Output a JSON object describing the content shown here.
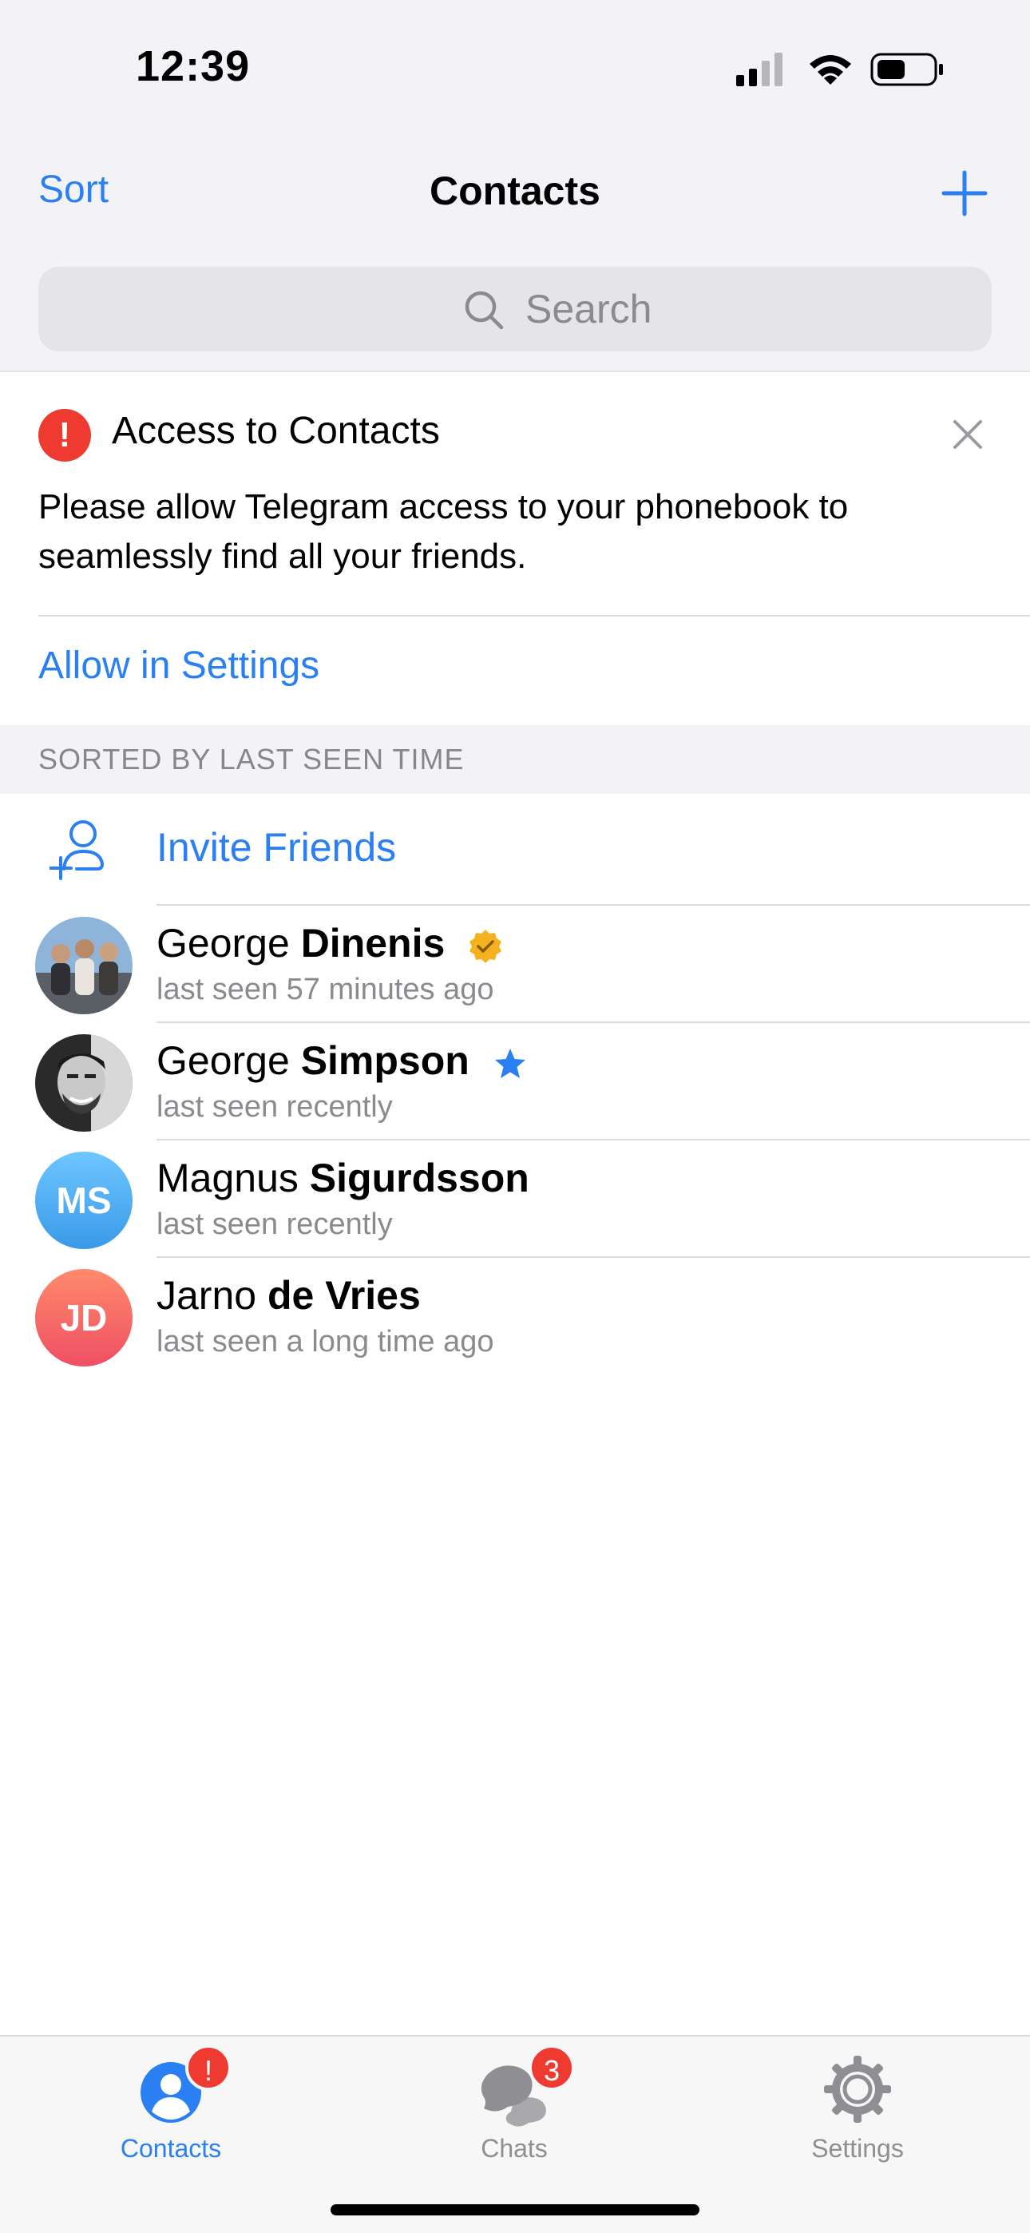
{
  "status_bar": {
    "time": "12:39"
  },
  "nav": {
    "sort_label": "Sort",
    "title": "Contacts"
  },
  "search": {
    "placeholder": "Search"
  },
  "banner": {
    "title": "Access to Contacts",
    "text": "Please allow Telegram access to your phonebook to seamlessly find all your friends.",
    "action": "Allow in Settings"
  },
  "section": {
    "header": "SORTED BY LAST SEEN TIME"
  },
  "invite": {
    "label": "Invite Friends"
  },
  "contacts": [
    {
      "first": "George",
      "last": "Dinenis",
      "status": "last seen 57 minutes ago",
      "badge": "verified-badge-icon"
    },
    {
      "first": "George",
      "last": "Simpson",
      "status": "last seen recently",
      "badge": "star-icon"
    },
    {
      "first": "Magnus",
      "last": "Sigurdsson",
      "status": "last seen recently",
      "initials": "MS",
      "color": "#3aa6ee"
    },
    {
      "first": "Jarno",
      "last": "de Vries",
      "status": "last seen a long time ago",
      "initials": "JD",
      "color": "#ef5a5e"
    }
  ],
  "tabs": [
    {
      "label": "Contacts",
      "badge": "!",
      "active": true,
      "icon": "contacts-icon"
    },
    {
      "label": "Chats",
      "badge": "3",
      "active": false,
      "icon": "chats-icon"
    },
    {
      "label": "Settings",
      "badge": "",
      "active": false,
      "icon": "settings-icon"
    }
  ],
  "colors": {
    "accent": "#2a7ff2",
    "alert": "#ee3a30",
    "gray_text": "#8a8a8f"
  }
}
